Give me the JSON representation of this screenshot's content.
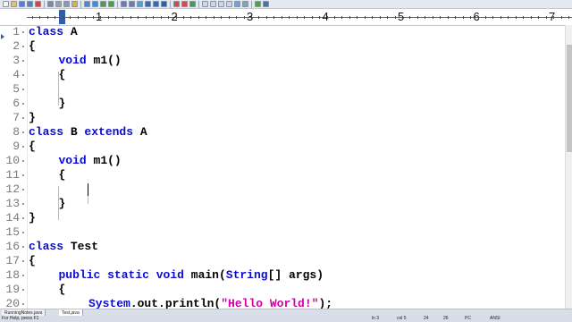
{
  "toolbar": {
    "icons": [
      "new-file",
      "open-file",
      "save",
      "save-all",
      "close",
      "print",
      "cut",
      "copy",
      "paste",
      "undo",
      "redo",
      "find",
      "replace",
      "zoom-in",
      "zoom-out",
      "sync",
      "wrap",
      "indent",
      "bookmark",
      "macro",
      "record",
      "play",
      "view-1",
      "view-2",
      "view-3",
      "view-4",
      "doc-map",
      "monitor",
      "run",
      "help"
    ]
  },
  "ruler": {
    "numbers": [
      "1",
      "2",
      "3",
      "4",
      "5",
      "6",
      "7"
    ]
  },
  "editor": {
    "lines": [
      {
        "n": "1",
        "indent": 0,
        "tokens": [
          {
            "t": "class",
            "c": "kw"
          },
          {
            "t": " A",
            "c": "cls"
          }
        ]
      },
      {
        "n": "2",
        "indent": 0,
        "tokens": [
          {
            "t": "{",
            "c": "cls"
          }
        ]
      },
      {
        "n": "3",
        "indent": 1,
        "tokens": [
          {
            "t": "void",
            "c": "kw"
          },
          {
            "t": " m1()",
            "c": "cls"
          }
        ]
      },
      {
        "n": "4",
        "indent": 1,
        "tokens": [
          {
            "t": "{",
            "c": "cls"
          }
        ]
      },
      {
        "n": "5",
        "indent": 1,
        "tokens": []
      },
      {
        "n": "6",
        "indent": 1,
        "tokens": [
          {
            "t": "}",
            "c": "cls"
          }
        ]
      },
      {
        "n": "7",
        "indent": 0,
        "tokens": [
          {
            "t": "}",
            "c": "cls"
          }
        ]
      },
      {
        "n": "8",
        "indent": 0,
        "tokens": [
          {
            "t": "class",
            "c": "kw"
          },
          {
            "t": " B ",
            "c": "cls"
          },
          {
            "t": "extends",
            "c": "kw"
          },
          {
            "t": " A",
            "c": "cls"
          }
        ]
      },
      {
        "n": "9",
        "indent": 0,
        "tokens": [
          {
            "t": "{",
            "c": "cls"
          }
        ]
      },
      {
        "n": "10",
        "indent": 1,
        "tokens": [
          {
            "t": "void",
            "c": "kw"
          },
          {
            "t": " m1()",
            "c": "cls"
          }
        ]
      },
      {
        "n": "11",
        "indent": 1,
        "tokens": [
          {
            "t": "{",
            "c": "cls"
          }
        ]
      },
      {
        "n": "12",
        "indent": 1,
        "tokens": []
      },
      {
        "n": "13",
        "indent": 1,
        "tokens": [
          {
            "t": "}",
            "c": "cls"
          }
        ]
      },
      {
        "n": "14",
        "indent": 0,
        "tokens": [
          {
            "t": "}",
            "c": "cls"
          }
        ]
      },
      {
        "n": "15",
        "indent": 0,
        "tokens": []
      },
      {
        "n": "16",
        "indent": 0,
        "tokens": [
          {
            "t": "class",
            "c": "kw"
          },
          {
            "t": " Test",
            "c": "cls"
          }
        ]
      },
      {
        "n": "17",
        "indent": 0,
        "tokens": [
          {
            "t": "{",
            "c": "cls"
          }
        ]
      },
      {
        "n": "18",
        "indent": 1,
        "tokens": [
          {
            "t": "public",
            "c": "kw"
          },
          {
            "t": " ",
            "c": "cls"
          },
          {
            "t": "static",
            "c": "kw"
          },
          {
            "t": " ",
            "c": "cls"
          },
          {
            "t": "void",
            "c": "kw"
          },
          {
            "t": " main(",
            "c": "cls"
          },
          {
            "t": "String",
            "c": "kw"
          },
          {
            "t": "[] args)",
            "c": "cls"
          }
        ]
      },
      {
        "n": "19",
        "indent": 1,
        "tokens": [
          {
            "t": "{",
            "c": "cls"
          }
        ]
      },
      {
        "n": "20",
        "indent": 2,
        "tokens": [
          {
            "t": "System",
            "c": "kw"
          },
          {
            "t": ".out.println(",
            "c": "cls"
          },
          {
            "t": "\"Hello World!\"",
            "c": "str"
          },
          {
            "t": ");",
            "c": "cls"
          }
        ]
      }
    ],
    "current_line": "3"
  },
  "tabs": [
    {
      "label": "RunningNotes.java",
      "active": false
    },
    {
      "label": "Test.java",
      "active": true
    }
  ],
  "status": {
    "help": "For Help, press F1",
    "line": "ln 3",
    "col": "col 5",
    "v1": "24",
    "v2": "26",
    "mode": "PC",
    "enc": "ANSI"
  },
  "colors": {
    "keyword": "#0b0bd6",
    "string": "#d100a6",
    "line_number": "#7a7a7a"
  }
}
